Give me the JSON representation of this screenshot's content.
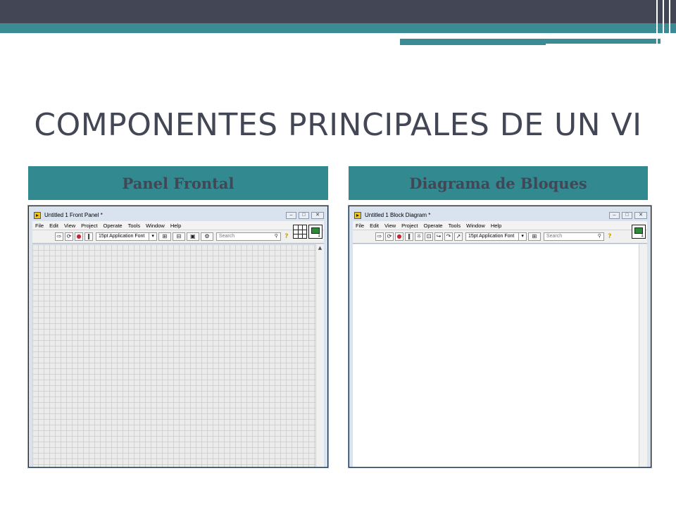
{
  "slide": {
    "title": "COMPONENTES PRINCIPALES DE UN VI",
    "colors": {
      "dark": "#434655",
      "teal": "#3b8b95",
      "header_teal": "#338990"
    }
  },
  "panes": [
    {
      "header": "Panel Frontal",
      "window": {
        "title": "Untitled 1 Front Panel *",
        "menu": [
          "File",
          "Edit",
          "View",
          "Project",
          "Operate",
          "Tools",
          "Window",
          "Help"
        ],
        "font_selector": "15pt Application Font",
        "search_placeholder": "Search",
        "help_icon": "?"
      }
    },
    {
      "header": "Diagrama de Bloques",
      "window": {
        "title": "Untitled 1 Block Diagram *",
        "menu": [
          "File",
          "Edit",
          "View",
          "Project",
          "Operate",
          "Tools",
          "Window",
          "Help"
        ],
        "font_selector": "15pt Application Font",
        "search_placeholder": "Search",
        "help_icon": "?"
      }
    }
  ]
}
